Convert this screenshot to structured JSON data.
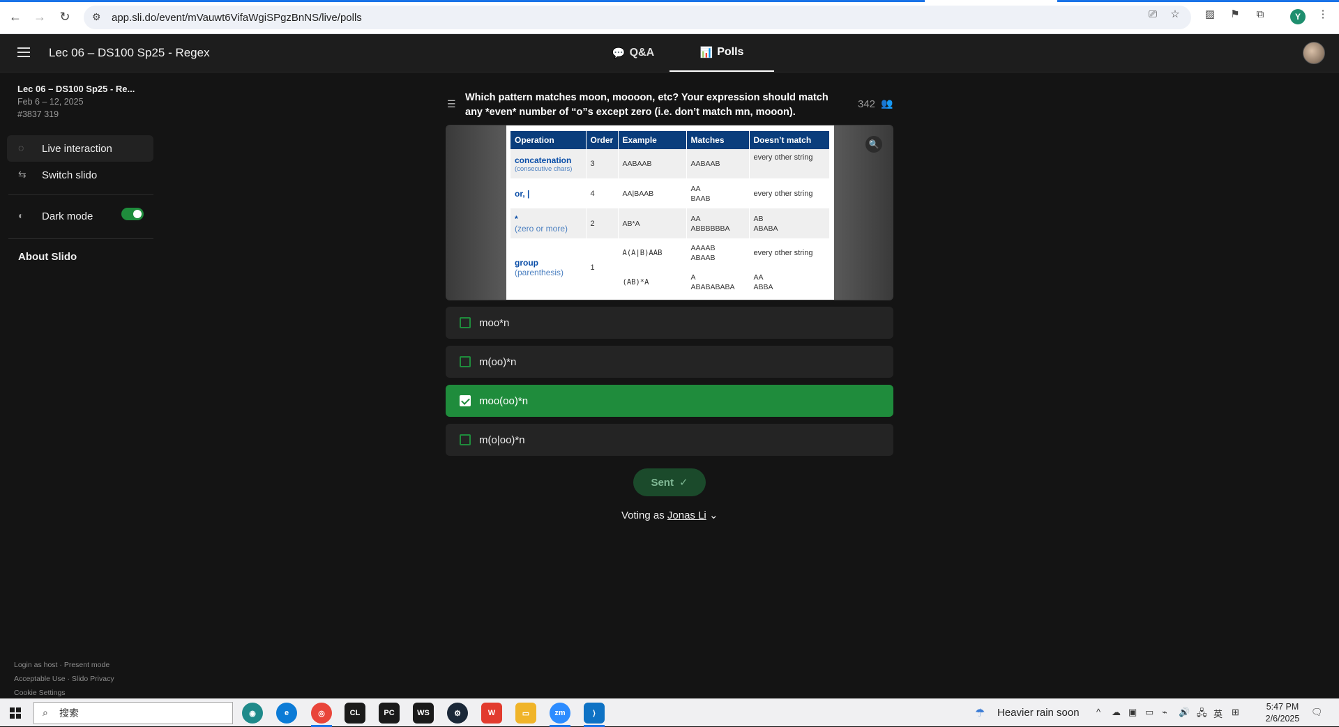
{
  "browser": {
    "url": "app.sli.do/event/mVauwt6VifaWgiSPgzBnNS/live/polls",
    "profile_initial": "Y"
  },
  "header": {
    "event_title": "Lec 06 – DS100 Sp25 - Regex",
    "tabs": [
      {
        "label": "Q&A",
        "icon": "speech-bubble-icon"
      },
      {
        "label": "Polls",
        "icon": "bar-chart-icon"
      }
    ]
  },
  "sidebar": {
    "event_name": "Lec 06 – DS100 Sp25 - Re...",
    "dates": "Feb 6 – 12, 2025",
    "code": "#3837 319",
    "items": [
      {
        "label": "Live interaction",
        "icon": "speech-bubbles-icon"
      },
      {
        "label": "Switch slido",
        "icon": "swap-arrows-icon"
      }
    ],
    "dark_mode_label": "Dark mode",
    "dark_mode_on": true,
    "about_label": "About Slido",
    "footer": {
      "login_host": "Login as host",
      "present_mode": "Present mode",
      "acceptable_use": "Acceptable Use",
      "privacy": "Slido Privacy",
      "cookie": "Cookie Settings",
      "separator": "·"
    }
  },
  "poll": {
    "question": "Which pattern matches moon, moooon, etc? Your expression should match any *even* number of “o”s except zero (i.e. don’t match mn, mooon).",
    "voter_count": "342",
    "table": {
      "headers": [
        "Operation",
        "Order",
        "Example",
        "Matches",
        "Doesn’t match"
      ],
      "rows": [
        {
          "op": "concatenation",
          "sub": "(consecutive chars)",
          "order": "3",
          "example": "AABAAB",
          "matches": "AABAAB",
          "not": "every other string"
        },
        {
          "op": "or, |",
          "sub": "",
          "order": "4",
          "example": "AA|BAAB",
          "matches": [
            "AA",
            "BAAB"
          ],
          "not": "every other string"
        },
        {
          "op": "*",
          "sub": "(zero or more)",
          "order": "2",
          "example": "AB*A",
          "matches": [
            "AA",
            "ABBBBBBA"
          ],
          "not": [
            "AB",
            "ABABA"
          ]
        },
        {
          "op": "group",
          "sub": "(parenthesis)",
          "order": "1",
          "example": "A(A|B)AAB",
          "matches": [
            "AAAAB",
            "ABAAB"
          ],
          "not": "every other string"
        },
        {
          "op": "",
          "sub": "",
          "order": "",
          "example": "(AB)*A",
          "matches": [
            "A",
            "ABABABABA"
          ],
          "not": [
            "AA",
            "ABBA"
          ]
        }
      ]
    },
    "options": [
      {
        "label": "moo*n",
        "selected": false
      },
      {
        "label": "m(oo)*n",
        "selected": false
      },
      {
        "label": "moo(oo)*n",
        "selected": true
      },
      {
        "label": "m(o|oo)*n",
        "selected": false
      }
    ],
    "sent_label": "Sent",
    "voting_as_prefix": "Voting as",
    "voter_name": "Jonas Li"
  },
  "taskbar": {
    "search_placeholder": "搜索",
    "weather": "Heavier rain soon",
    "ime": "英",
    "time": "5:47 PM",
    "date": "2/6/2025"
  },
  "colors": {
    "accent_green": "#1f8c3c",
    "background": "#141414",
    "header_blue": "#0a3d7c"
  }
}
